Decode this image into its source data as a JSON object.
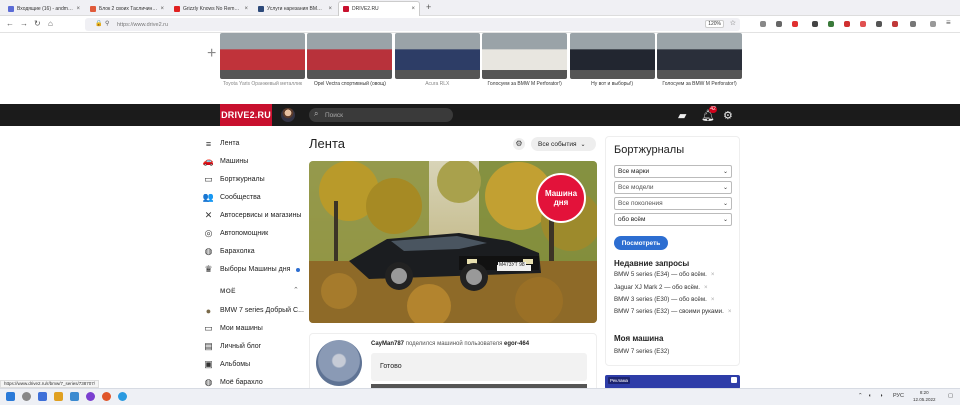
{
  "browser": {
    "tabs": [
      {
        "label": "Входящие (16) - andmwod@m...",
        "color": "#5b6bd6",
        "active": false
      },
      {
        "label": "Блок 2 своих Тасличинника с...",
        "color": "#e05a3a",
        "active": false
      },
      {
        "label": "Grizzly Knows No Remorse - Ва... воспроизводится",
        "color": "#e02020",
        "active": false
      },
      {
        "label": "Услуги нарезания BMW E3...",
        "color": "#2d4a7a",
        "active": false
      },
      {
        "label": "DRIVE2.RU",
        "color": "#c8102e",
        "active": true
      }
    ],
    "url": "https://www.drive2.ru",
    "zoom": "120%",
    "status_hint": "https://www.drive2.ru/r/bmw/7_series/738707/"
  },
  "car_strip": [
    {
      "caption": "Toyota Yaris Оранжевый металлик",
      "gray": true,
      "color": "#c0333a"
    },
    {
      "caption": "Opel Vectra спортивный (овощ)",
      "gray": false,
      "color": "#b8323b"
    },
    {
      "caption": "Acura RLX",
      "gray": true,
      "color": "#2d3d66"
    },
    {
      "caption": "Голосуем за BMW M Perforator!)",
      "gray": false,
      "color": "#e8e6e0"
    },
    {
      "caption": "Ну вот и выборы!)",
      "gray": false,
      "color": "#222630"
    },
    {
      "caption": "Голосуем за BMW M Perforator!)",
      "gray": false,
      "color": "#2a2f3a"
    }
  ],
  "header": {
    "logo": "DRIVE2.RU",
    "search_placeholder": "Поиск",
    "notification_count": "42"
  },
  "sidebar": {
    "items": [
      {
        "label": "Лента",
        "icon": "feed-icon",
        "glyph": "≡",
        "dot": false
      },
      {
        "label": "Машины",
        "icon": "car-icon",
        "glyph": "🚗",
        "dot": false
      },
      {
        "label": "Бортжурналы",
        "icon": "book-icon",
        "glyph": "▭",
        "dot": false
      },
      {
        "label": "Сообщества",
        "icon": "community-icon",
        "glyph": "👥",
        "dot": false
      },
      {
        "label": "Автосервисы и магазины",
        "icon": "wrench-icon",
        "glyph": "✕",
        "dot": false
      },
      {
        "label": "Автопомощник",
        "icon": "assistant-icon",
        "glyph": "◎",
        "dot": false
      },
      {
        "label": "Барахолка",
        "icon": "bag-icon",
        "glyph": "◍",
        "dot": false
      },
      {
        "label": "Выборы Машины дня",
        "icon": "trophy-icon",
        "glyph": "♛",
        "dot": true
      }
    ],
    "mine_label": "МОЁ",
    "mine_items": [
      {
        "label": "BMW 7 series Добрый С...",
        "icon": "car-thumb-icon",
        "glyph": "●"
      },
      {
        "label": "Мои машины",
        "icon": "mycars-icon",
        "glyph": "▭"
      },
      {
        "label": "Личный блог",
        "icon": "blog-icon",
        "glyph": "▤"
      },
      {
        "label": "Альбомы",
        "icon": "album-icon",
        "glyph": "▣"
      },
      {
        "label": "Моё барахло",
        "icon": "stuff-icon",
        "glyph": "◍"
      }
    ]
  },
  "feed": {
    "title": "Лента",
    "filter": "Все события",
    "hero_badge": "Машина дня",
    "plate": "М473УТ 98",
    "post": {
      "author": "CayMan787",
      "action": "поделился машиной пользователя",
      "target": "egor-464",
      "text": "Готово"
    }
  },
  "right": {
    "title": "Бортжурналы",
    "selects": [
      "Все марки",
      "Все модели",
      "Все поколения",
      "обо всём"
    ],
    "button": "Посмотреть",
    "recent_title": "Недавние запросы",
    "recent": [
      "BMW 5 series (E34) — обо всём.",
      "Jaguar XJ Mark 2 — обо всём.",
      "BMW 3 series (E30) — обо всём.",
      "BMW 7 series (E32) — своими руками."
    ],
    "mycar_title": "Моя машина",
    "mycar": "BMW 7 series (E32)",
    "ad_tag": "Реклама"
  },
  "taskbar": {
    "time": "8:20",
    "date": "12.05.2022",
    "lang": "РУС"
  }
}
